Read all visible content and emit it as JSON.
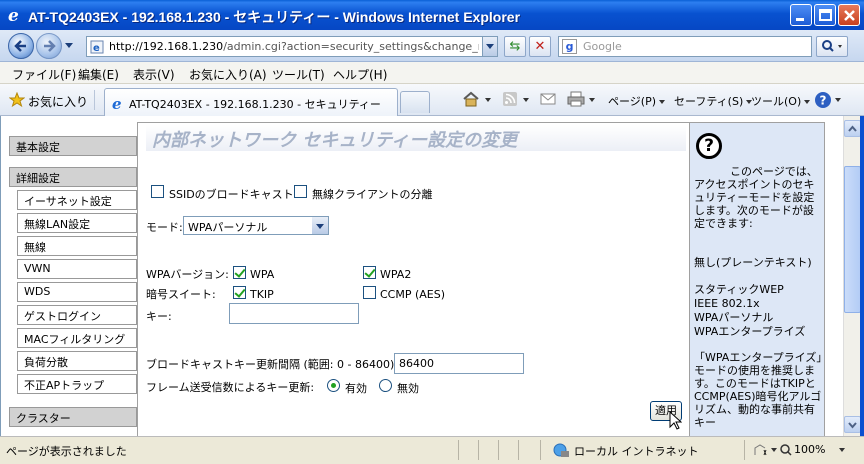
{
  "window": {
    "title": "AT-TQ2403EX - 192.168.1.230 - セキュリティー - Windows Internet Explorer"
  },
  "address": {
    "url_host": "http://192.168.1.230",
    "url_path": "/admin.cgi?action=security_settings&change_mode_vi"
  },
  "search": {
    "placeholder": "Google"
  },
  "menu": [
    "ファイル(F)",
    "編集(E)",
    "表示(V)",
    "お気に入り(A)",
    "ツール(T)",
    "ヘルプ(H)"
  ],
  "favorites": {
    "label": "お気に入り"
  },
  "tab": {
    "title": "AT-TQ2403EX - 192.168.1.230 - セキュリティー"
  },
  "commands": {
    "page": "ページ(P)",
    "safety": "セーフティ(S)",
    "tools": "ツール(O)"
  },
  "nav": {
    "basic": "基本設定",
    "advanced": "詳細設定",
    "items": [
      "イーサネット設定",
      "無線LAN設定",
      "無線",
      "VWN",
      "WDS",
      "ゲストログイン",
      "MACフィルタリング",
      "負荷分散",
      "不正APトラップ"
    ],
    "cluster": "クラスター"
  },
  "main": {
    "heading": "内部ネットワーク セキュリティー設定の変更",
    "ssid_broadcast": "SSIDのブロードキャスト",
    "client_isolation": "無線クライアントの分離",
    "mode_label": "モード:",
    "mode_value": "WPAパーソナル",
    "wpa_version_label": "WPAバージョン:",
    "wpa": "WPA",
    "wpa2": "WPA2",
    "cipher_label": "暗号スイート:",
    "tkip": "TKIP",
    "ccmp": "CCMP (AES)",
    "key_label": "キー:",
    "key_value": "",
    "rekey_label": "ブロードキャストキー更新間隔 (範囲: 0 - 86400):",
    "rekey_value": "86400",
    "frame_rekey_label": "フレーム送受信数によるキー更新:",
    "enabled": "有効",
    "disabled": "無効",
    "apply": "適用"
  },
  "help": {
    "p1": "このページでは、アクセスポイントのセキュリティーモードを設定します。次のモードが設定できます:",
    "modes": [
      "無し(プレーンテキスト)",
      "スタティックWEP",
      "IEEE 802.1x",
      "WPAパーソナル",
      "WPAエンタープライズ"
    ],
    "p2": "「WPAエンタープライズ」モードの使用を推奨します。このモードはTKIPとCCMP(AES)暗号化アルゴリズム、動的な事前共有キー"
  },
  "status": {
    "text": "ページが表示されました",
    "zone": "ローカル イントラネット",
    "zoom": "100%"
  },
  "state": {
    "ssid_broadcast": false,
    "client_isolation": false,
    "wpa": true,
    "wpa2": true,
    "tkip": true,
    "ccmp": false,
    "frame_rekey": "enabled"
  }
}
